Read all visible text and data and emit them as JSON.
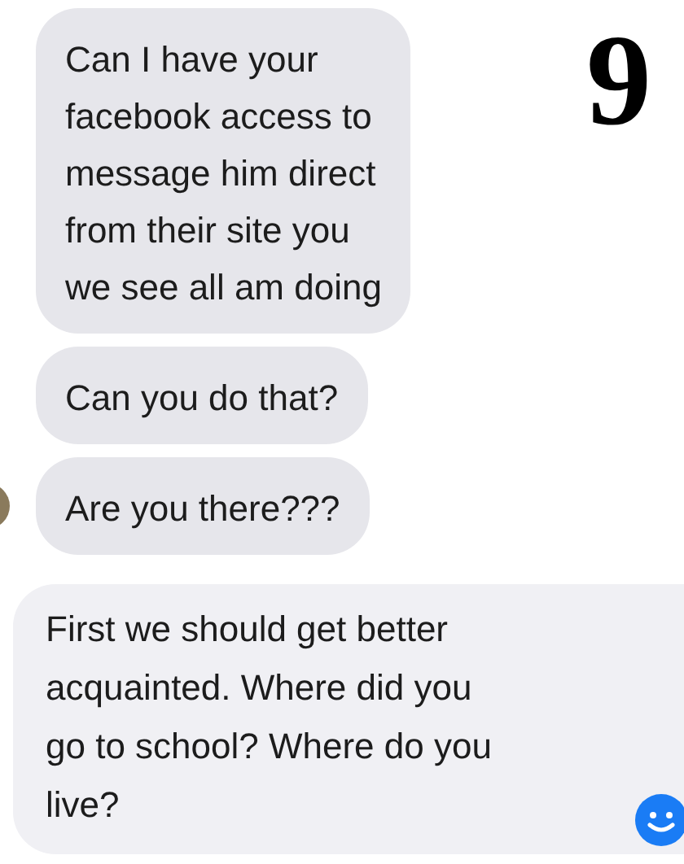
{
  "number": "9",
  "messages": [
    {
      "text": "Can I have your\nfacebook access to\nmessage him direct\nfrom their site you\nwe see all am doing",
      "avatar": false
    },
    {
      "text": "Can you do that?",
      "avatar": false
    },
    {
      "text": "Are you there???",
      "avatar": true
    }
  ],
  "reply": {
    "text": "First we should get better\nacquainted. Where did you\ngo to school? Where do you\nlive?"
  }
}
